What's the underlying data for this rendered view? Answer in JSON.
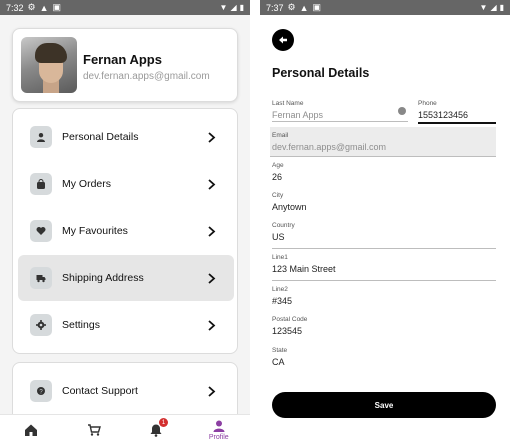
{
  "left_screen": {
    "status": {
      "time": "7:32"
    },
    "profile": {
      "name": "Fernan Apps",
      "email": "dev.fernan.apps@gmail.com"
    },
    "menu": [
      {
        "label": "Personal Details",
        "icon": "user-icon"
      },
      {
        "label": "My Orders",
        "icon": "bag-icon"
      },
      {
        "label": "My Favourites",
        "icon": "heart-icon"
      },
      {
        "label": "Shipping Address",
        "icon": "truck-icon"
      },
      {
        "label": "Settings",
        "icon": "gear-icon"
      }
    ],
    "menu2": [
      {
        "label": "Contact Support",
        "icon": "support-icon"
      }
    ],
    "bottom_nav": {
      "active_label": "Profile",
      "notification_count": "1"
    }
  },
  "right_screen": {
    "status": {
      "time": "7:37"
    },
    "title": "Personal Details",
    "fields": {
      "last_name": {
        "label": "Last Name",
        "value": "Fernan Apps"
      },
      "phone": {
        "label": "Phone",
        "value": "1553123456"
      },
      "email": {
        "label": "Email",
        "value": "dev.fernan.apps@gmail.com"
      },
      "age": {
        "label": "Age",
        "value": "26"
      },
      "city": {
        "label": "City",
        "value": "Anytown"
      },
      "country": {
        "label": "Country",
        "value": "US"
      },
      "line1": {
        "label": "Line1",
        "value": "123 Main Street"
      },
      "line2": {
        "label": "Line2",
        "value": "#345"
      },
      "postal_code": {
        "label": "Postal Code",
        "value": "123545"
      },
      "state": {
        "label": "State",
        "value": "CA"
      }
    },
    "save_label": "Save"
  },
  "colors": {
    "accent": "#8c3fa3",
    "primary_button": "#000000",
    "status_bar": "#666666",
    "badge": "#d32f2f"
  }
}
